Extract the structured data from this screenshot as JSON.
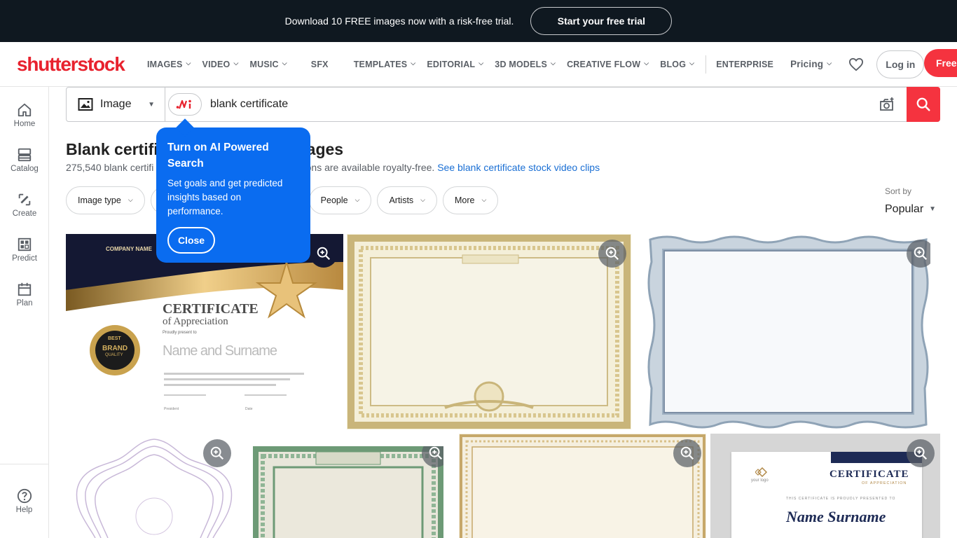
{
  "promo": {
    "text": "Download 10 FREE images now with a risk-free trial.",
    "button": "Start your free trial"
  },
  "header": {
    "logo": "shutterstock",
    "nav": [
      {
        "label": "IMAGES",
        "dropdown": true
      },
      {
        "label": "VIDEO",
        "dropdown": true
      },
      {
        "label": "MUSIC",
        "dropdown": true
      },
      {
        "label": "SFX",
        "dropdown": false
      },
      {
        "label": "TEMPLATES",
        "dropdown": true
      },
      {
        "label": "EDITORIAL",
        "dropdown": true
      },
      {
        "label": "3D MODELS",
        "dropdown": true
      },
      {
        "label": "CREATIVE FLOW",
        "dropdown": true
      },
      {
        "label": "BLOG",
        "dropdown": true
      }
    ],
    "enterprise": "ENTERPRISE",
    "pricing": "Pricing",
    "login": "Log in",
    "free_button": "Free t",
    "icons": {
      "wishlist": "heart-icon",
      "chevron": "chevron-down-icon"
    }
  },
  "sidebar": {
    "items": [
      {
        "label": "Home",
        "icon": "home-icon"
      },
      {
        "label": "Catalog",
        "icon": "catalog-icon"
      },
      {
        "label": "Create",
        "icon": "create-icon"
      },
      {
        "label": "Predict",
        "icon": "predict-icon"
      },
      {
        "label": "Plan",
        "icon": "calendar-icon"
      }
    ],
    "help": "Help"
  },
  "search": {
    "type": "Image",
    "query": "blank certificate",
    "icons": {
      "type": "image-icon",
      "ai": "ai-search-icon",
      "visual": "camera-search-icon",
      "submit": "search-icon"
    }
  },
  "results": {
    "title_left": "Blank certifi",
    "title_right": "ages",
    "subtitle_left": "275,540 blank certifi",
    "subtitle_mid": "trations are available royalty-free.",
    "subtitle_link": "See blank certificate stock video clips"
  },
  "filters": [
    {
      "label": "Image type"
    },
    {
      "label": "People"
    },
    {
      "label": "Artists"
    },
    {
      "label": "More"
    }
  ],
  "sort": {
    "label": "Sort by",
    "value": "Popular"
  },
  "tooltip": {
    "title": "Turn on AI Powered Search",
    "body": "Set goals and get predicted insights based on performance.",
    "close": "Close"
  },
  "thumbnails": {
    "t1": {
      "company": "COMPANY NAME",
      "heading": "CERTIFICATE",
      "subheading": "of Appreciation",
      "proudly": "Proudly present to",
      "name": "Name and Surname",
      "badge_top": "BEST",
      "badge_mid": "BRAND",
      "badge_bot": "QUALITY",
      "sig1": "President",
      "sig2": "Date"
    },
    "t7": {
      "heading": "CERTIFICATE",
      "subheading": "OF APPRECIATION",
      "presented": "THIS CERTIFICATE IS PROUDLY PRESENTED TO",
      "name": "Name Surname",
      "logo": "your logo"
    }
  }
}
